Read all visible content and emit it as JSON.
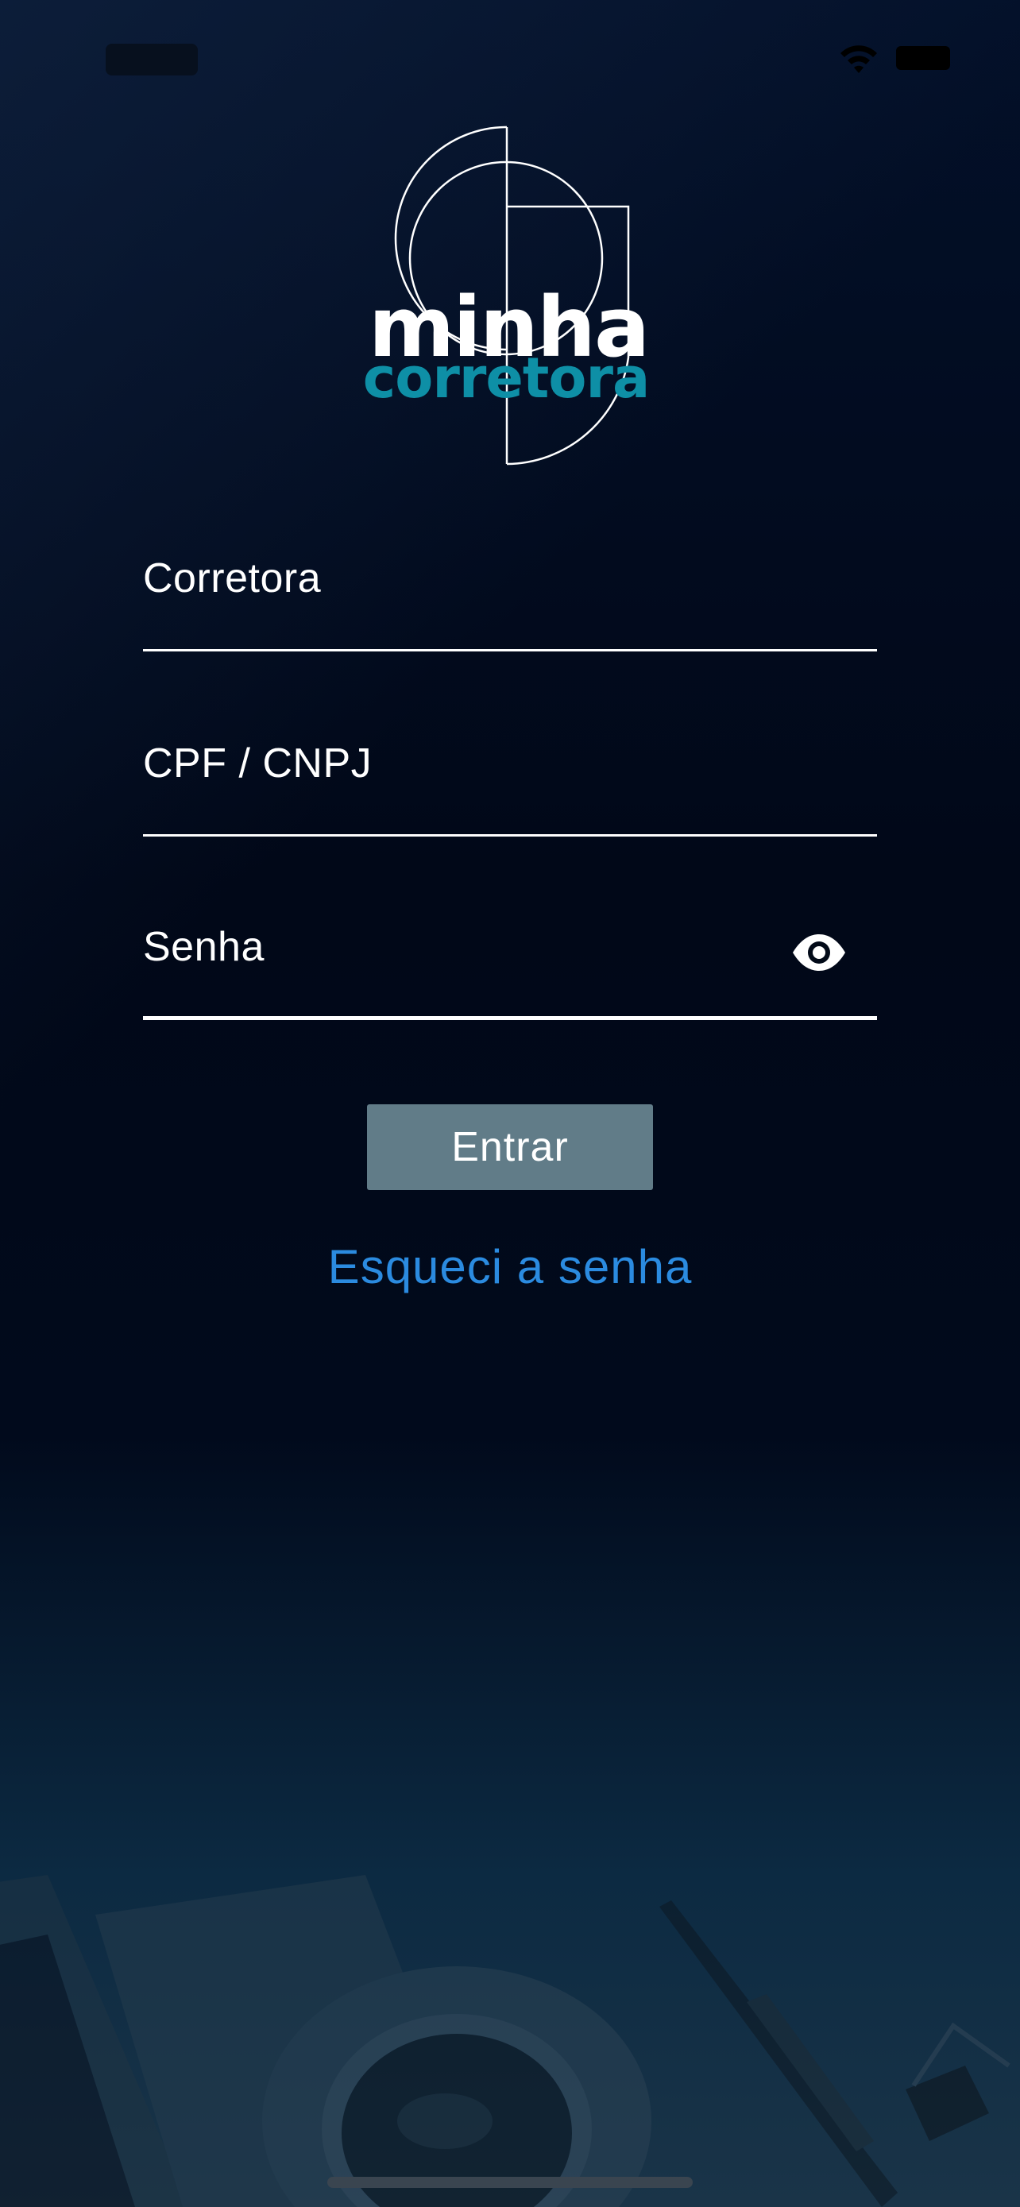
{
  "brand": {
    "line1": "minha",
    "line2": "corretora",
    "accent_color": "#0e8fa6"
  },
  "form": {
    "broker_label": "Corretora",
    "document_label": "CPF / CNPJ",
    "password_label": "Senha",
    "login_label": "Entrar",
    "forgot_password_label": "Esqueci a senha"
  },
  "icons": {
    "wifi": "wifi-icon",
    "battery": "battery-icon",
    "show_password": "eye-icon"
  },
  "colors": {
    "button_bg": "#617c88",
    "link": "#2b8be0",
    "background": "#020a18"
  }
}
